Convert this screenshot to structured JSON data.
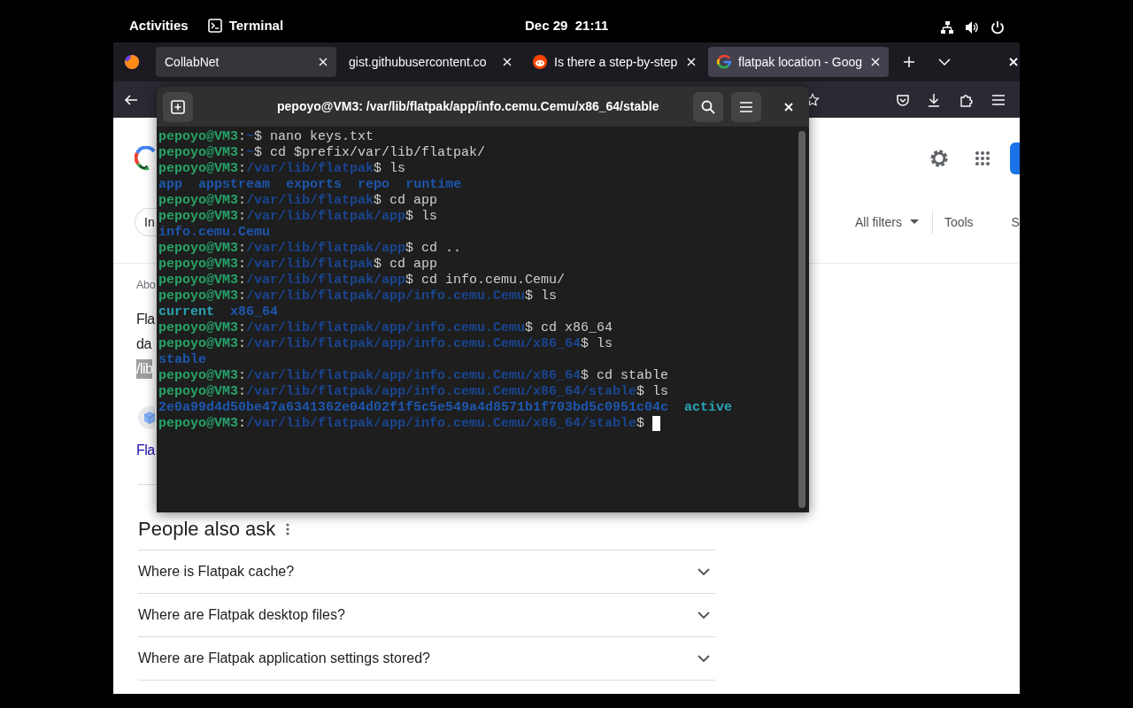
{
  "top_bar": {
    "activities": "Activities",
    "app": "Terminal",
    "clock": "Dec 29  21:11"
  },
  "browser": {
    "tabs": [
      {
        "title": "CollabNet",
        "kind": "plain",
        "selected": false,
        "hovered": true
      },
      {
        "title": "gist.githubusercontent.co",
        "kind": "plain",
        "selected": false,
        "hovered": false
      },
      {
        "title": "Is there a step-by-step",
        "kind": "reddit",
        "selected": false,
        "hovered": false
      },
      {
        "title": "flatpak location - Goog",
        "kind": "google",
        "selected": true,
        "hovered": false
      }
    ]
  },
  "search_page": {
    "filter_chip": "In",
    "all_filters": "All filters",
    "tools": "Tools",
    "cut_tab": "S",
    "result": {
      "about": "Abo",
      "title_lines": [
        "Fla",
        "da"
      ],
      "highlight": "/lib",
      "link": "Fla"
    },
    "people_also_ask": {
      "title": "People also ask",
      "questions": [
        {
          "text": "Where is Flatpak cache?",
          "expanded": false
        },
        {
          "text": "Where are Flatpak desktop files?",
          "expanded": false
        },
        {
          "text": "Where are Flatpak application settings stored?",
          "expanded": false
        }
      ]
    }
  },
  "terminal": {
    "title": "pepoyo@VM3: /var/lib/flatpak/app/info.cemu.Cemu/x86_64/stable",
    "lines": [
      {
        "kind": "prompt",
        "user": "pepoyo@VM3",
        "colon": ":",
        "path": "~",
        "command": "$ nano keys.txt"
      },
      {
        "kind": "prompt",
        "user": "pepoyo@VM3",
        "colon": ":",
        "path": "~",
        "command": "$ cd $prefix/var/lib/flatpak/"
      },
      {
        "kind": "prompt",
        "user": "pepoyo@VM3",
        "colon": ":",
        "path": "/var/lib/flatpak",
        "command": "$ ls"
      },
      {
        "kind": "output",
        "items": [
          {
            "text": "app",
            "kind": "dir"
          },
          {
            "text": "appstream",
            "kind": "dir"
          },
          {
            "text": "exports",
            "kind": "dir"
          },
          {
            "text": "repo",
            "kind": "dir"
          },
          {
            "text": "runtime",
            "kind": "dir"
          }
        ]
      },
      {
        "kind": "prompt",
        "user": "pepoyo@VM3",
        "colon": ":",
        "path": "/var/lib/flatpak",
        "command": "$ cd app"
      },
      {
        "kind": "prompt",
        "user": "pepoyo@VM3",
        "colon": ":",
        "path": "/var/lib/flatpak/app",
        "command": "$ ls"
      },
      {
        "kind": "output",
        "items": [
          {
            "text": "info.cemu.Cemu",
            "kind": "dir"
          }
        ]
      },
      {
        "kind": "prompt",
        "user": "pepoyo@VM3",
        "colon": ":",
        "path": "/var/lib/flatpak/app",
        "command": "$ cd .."
      },
      {
        "kind": "prompt",
        "user": "pepoyo@VM3",
        "colon": ":",
        "path": "/var/lib/flatpak",
        "command": "$ cd app"
      },
      {
        "kind": "prompt",
        "user": "pepoyo@VM3",
        "colon": ":",
        "path": "/var/lib/flatpak/app",
        "command": "$ cd info.cemu.Cemu/"
      },
      {
        "kind": "prompt",
        "user": "pepoyo@VM3",
        "colon": ":",
        "path": "/var/lib/flatpak/app/info.cemu.Cemu",
        "command": "$ ls"
      },
      {
        "kind": "output",
        "items": [
          {
            "text": "current",
            "kind": "link"
          },
          {
            "text": "x86_64",
            "kind": "dir"
          }
        ]
      },
      {
        "kind": "prompt",
        "user": "pepoyo@VM3",
        "colon": ":",
        "path": "/var/lib/flatpak/app/info.cemu.Cemu",
        "command": "$ cd x86_64"
      },
      {
        "kind": "prompt",
        "user": "pepoyo@VM3",
        "colon": ":",
        "path": "/var/lib/flatpak/app/info.cemu.Cemu/x86_64",
        "command": "$ ls"
      },
      {
        "kind": "output",
        "items": [
          {
            "text": "stable",
            "kind": "dir"
          }
        ]
      },
      {
        "kind": "prompt",
        "user": "pepoyo@VM3",
        "colon": ":",
        "path": "/var/lib/flatpak/app/info.cemu.Cemu/x86_64",
        "command": "$ cd stable"
      },
      {
        "kind": "prompt",
        "user": "pepoyo@VM3",
        "colon": ":",
        "path": "/var/lib/flatpak/app/info.cemu.Cemu/x86_64/stable",
        "command": "$ ls"
      },
      {
        "kind": "output",
        "items": [
          {
            "text": "2e0a99d4d50be47a6341362e04d02f1f5c5e549a4d8571b1f703bd5c0951c04c",
            "kind": "dir"
          },
          {
            "text": "active",
            "kind": "link"
          }
        ]
      },
      {
        "kind": "prompt",
        "user": "pepoyo@VM3",
        "colon": ":",
        "path": "/var/lib/flatpak/app/info.cemu.Cemu/x86_64/stable",
        "command": "$",
        "cursor": true
      }
    ]
  }
}
